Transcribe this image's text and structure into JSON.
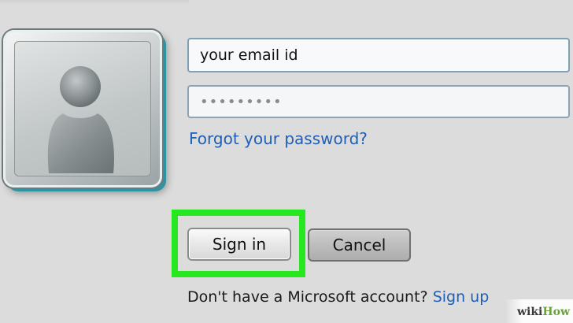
{
  "login": {
    "email_value": "your email id",
    "password_masked": "•••••••••",
    "forgot_password_link": "Forgot your password?",
    "sign_in_button": "Sign in",
    "cancel_button": "Cancel",
    "signup_prompt": "Don't have a Microsoft account?",
    "signup_link": "Sign up"
  },
  "avatar": {
    "icon": "user-silhouette-icon"
  },
  "highlight": {
    "color": "#27e81e",
    "target": "sign-in-button"
  },
  "watermark": {
    "wiki": "wiki",
    "how": "How"
  },
  "colors": {
    "background": "#dcdcdc",
    "link": "#1f5fb5",
    "avatar_accent": "#2f93a0",
    "watermark_green": "#6aa23a"
  }
}
